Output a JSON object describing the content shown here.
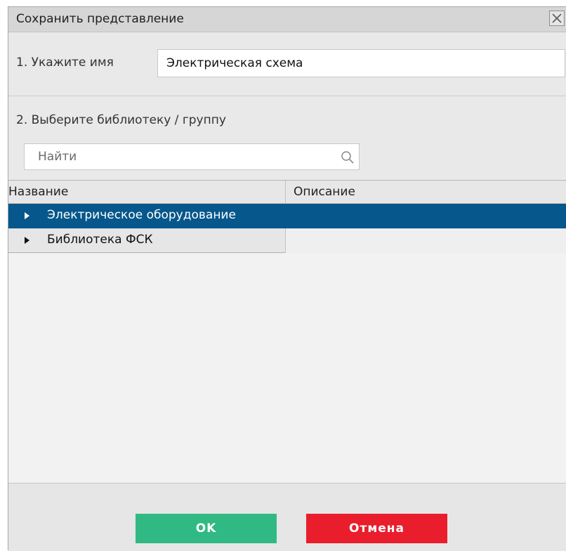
{
  "dialog": {
    "title": "Сохранить представление",
    "close_icon": "close-icon"
  },
  "name_section": {
    "label": "1. Укажите имя",
    "value": "Электрическая схема"
  },
  "group_section": {
    "label": "2. Выберите библиотеку / группу"
  },
  "search": {
    "placeholder": "Найти",
    "icon": "search-icon"
  },
  "table": {
    "columns": [
      "Название",
      "Описание"
    ],
    "rows": [
      {
        "name": "Электрическое оборудование",
        "description": "",
        "selected": true
      },
      {
        "name": "Библиотека ФСК",
        "description": "",
        "selected": false
      }
    ]
  },
  "buttons": {
    "ok_label": "OK",
    "cancel_label": "Отмена"
  },
  "colors": {
    "selected_row": "#06578b",
    "ok_button": "#31b984",
    "cancel_button": "#ea1d2c"
  }
}
